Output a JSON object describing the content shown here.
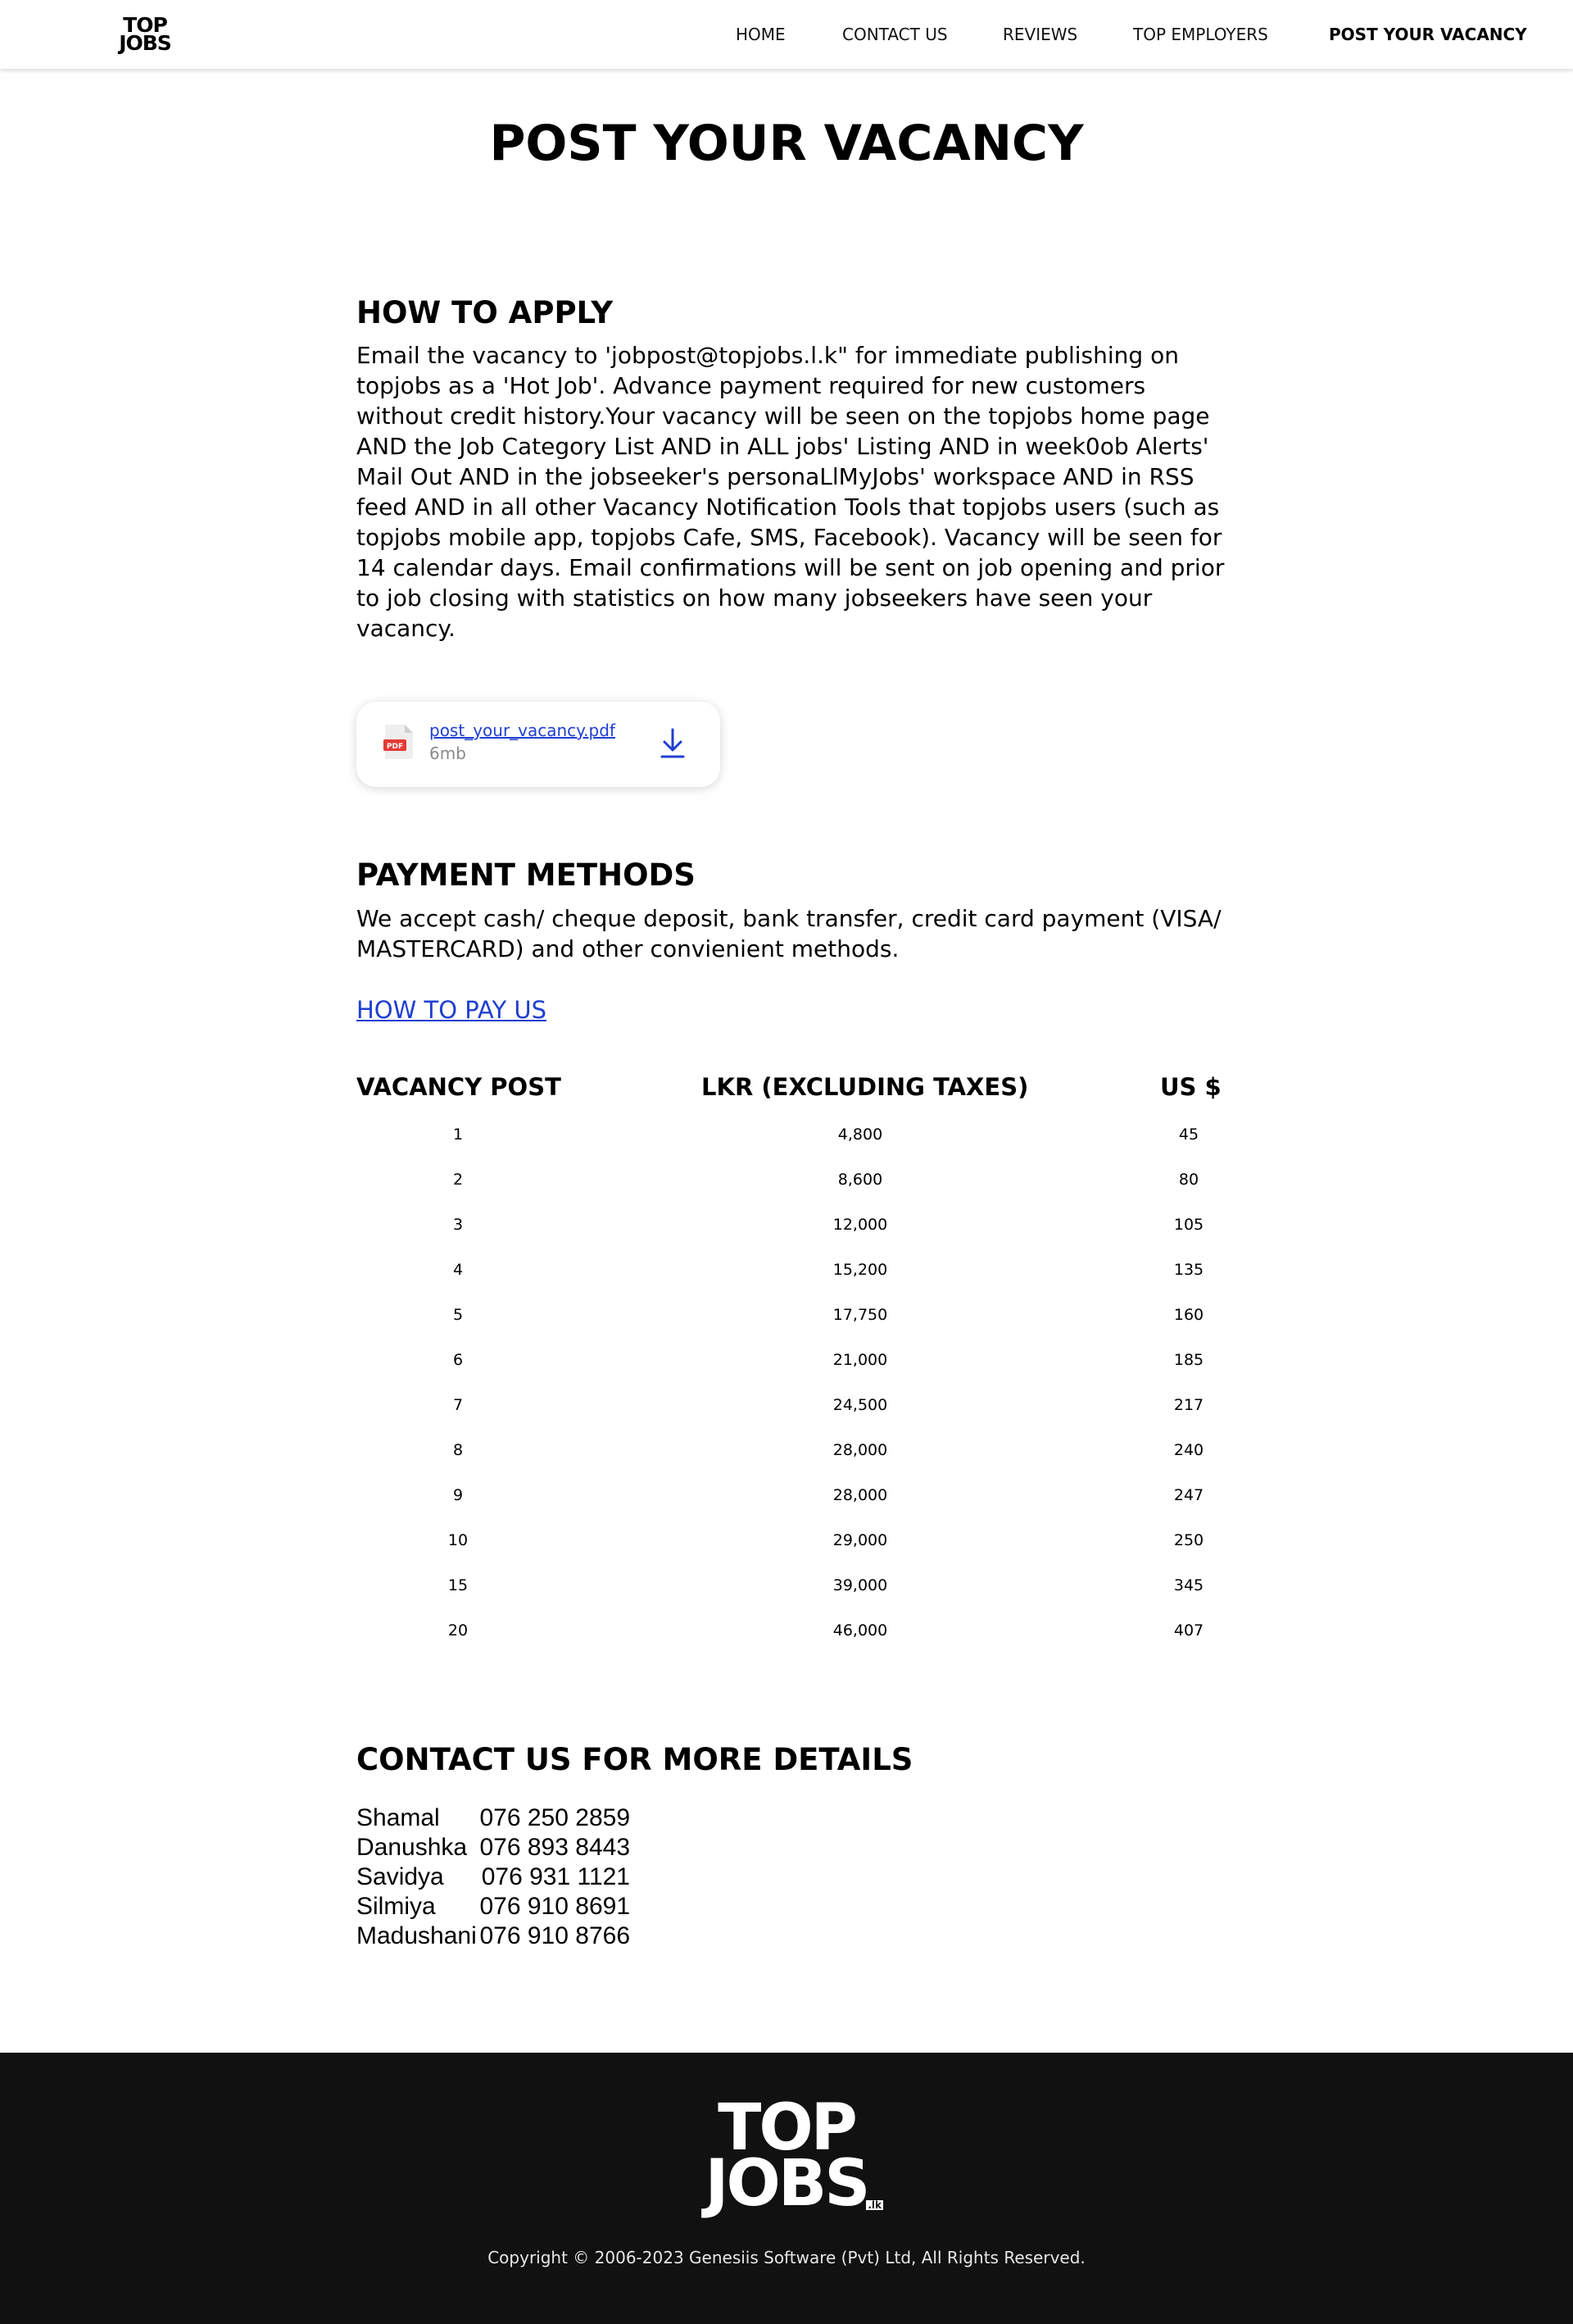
{
  "header": {
    "logo": {
      "line1": "TOP",
      "line2": "JOBS"
    },
    "nav": [
      {
        "label": "HOME",
        "active": false
      },
      {
        "label": "CONTACT US",
        "active": false
      },
      {
        "label": "REVIEWS",
        "active": false
      },
      {
        "label": "TOP EMPLOYERS",
        "active": false
      },
      {
        "label": "POST YOUR VACANCY",
        "active": true
      }
    ]
  },
  "main": {
    "title": "POST YOUR VACANCY",
    "how_to_apply": {
      "heading": "HOW TO APPLY",
      "text": "Email the vacancy to 'jobpost@topjobs.l.k\" for immediate publishing on topjobs as a 'Hot Job'. Advance payment required for new customers without credit history.Your vacancy will be seen on the topjobs home page AND the Job Category List AND in ALL jobs' Listing AND in week0ob Alerts' Mail Out AND in the jobseeker's personaLlMyJobs' workspace AND in RSS feed AND in all other Vacancy Notification Tools that topjobs users (such as topjobs mobile app, topjobs Cafe, SMS, Facebook). Vacancy will be seen for 14 calendar days. Email confirmations will be sent on job opening and prior to job closing with statistics on how many jobseekers have seen your vacancy."
    },
    "file": {
      "name": "post_your_vacancy.pdf",
      "size": "6mb",
      "icon_label": "PDF",
      "icon": "pdf-file-icon",
      "action_icon": "download-icon",
      "accent_color": "#1f3fd1"
    },
    "payment": {
      "heading": "PAYMENT METHODS",
      "text": "We accept cash/ cheque deposit, bank transfer, credit card payment (VISA/ MASTERCARD) and other convienient methods.",
      "link": "HOW TO PAY US"
    },
    "pricing": {
      "headers": {
        "col1": "VACANCY POST",
        "col2": "LKR (EXCLUDING TAXES)",
        "col3": "US $"
      },
      "rows": [
        [
          "1",
          "4,800",
          "45"
        ],
        [
          "2",
          "8,600",
          "80"
        ],
        [
          "3",
          "12,000",
          "105"
        ],
        [
          "4",
          "15,200",
          "135"
        ],
        [
          "5",
          "17,750",
          "160"
        ],
        [
          "6",
          "21,000",
          "185"
        ],
        [
          "7",
          "24,500",
          "217"
        ],
        [
          "8",
          "28,000",
          "240"
        ],
        [
          "9",
          "28,000",
          "247"
        ],
        [
          "10",
          "29,000",
          "250"
        ],
        [
          "15",
          "39,000",
          "345"
        ],
        [
          "20",
          "46,000",
          "407"
        ]
      ]
    },
    "contact": {
      "heading": "CONTACT US FOR MORE DETAILS",
      "people": [
        {
          "name": "Shamal",
          "phone": "076 250 2859"
        },
        {
          "name": "Danushka",
          "phone": "076 893 8443"
        },
        {
          "name": "Savidya",
          "phone": "076 931 1121"
        },
        {
          "name": "Silmiya",
          "phone": "076 910 8691"
        },
        {
          "name": "Madushani",
          "phone": "076 910 8766"
        }
      ]
    }
  },
  "footer": {
    "logo": {
      "line1": "TOP",
      "line2": "JOBS",
      "suffix": ".lk"
    },
    "copyright": "Copyright © 2006-2023 Genesiis Software (Pvt) Ltd, All Rights Reserved.",
    "background": "#111111"
  }
}
